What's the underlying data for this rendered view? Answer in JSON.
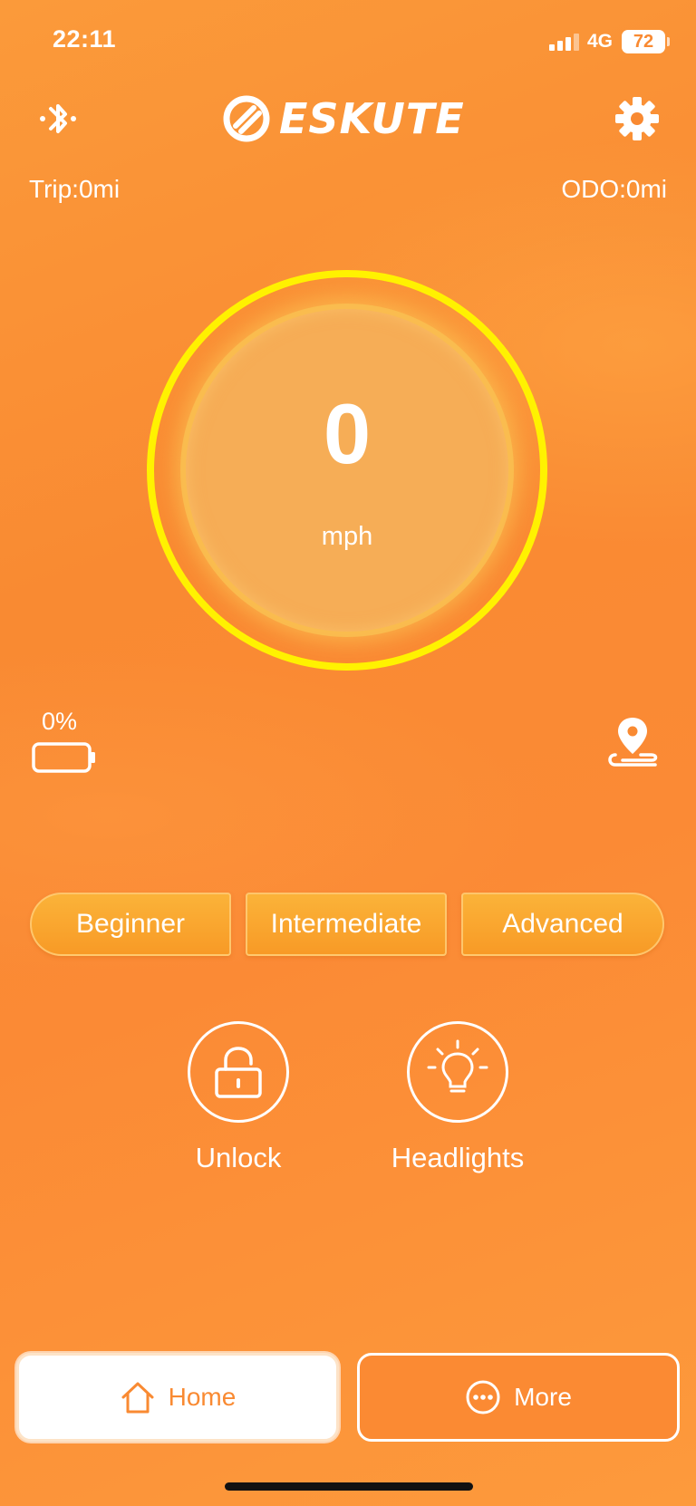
{
  "status_bar": {
    "time": "22:11",
    "network": "4G",
    "battery": "72"
  },
  "header": {
    "brand": "ESKUTE",
    "bluetooth_icon": "bluetooth-icon",
    "settings_icon": "gear-icon"
  },
  "stats": {
    "trip": "Trip:0mi",
    "odo": "ODO:0mi"
  },
  "speed": {
    "value": "0",
    "unit": "mph"
  },
  "battery": {
    "percent_label": "0%",
    "level": 0
  },
  "modes": [
    {
      "label": "Beginner"
    },
    {
      "label": "Intermediate"
    },
    {
      "label": "Advanced"
    }
  ],
  "actions": {
    "unlock_label": "Unlock",
    "headlights_label": "Headlights"
  },
  "tabs": {
    "home_label": "Home",
    "more_label": "More"
  },
  "colors": {
    "background": "#f98a32",
    "ring": "#fff200",
    "mode_button": "#f8a82e",
    "accent": "#f98a32"
  }
}
